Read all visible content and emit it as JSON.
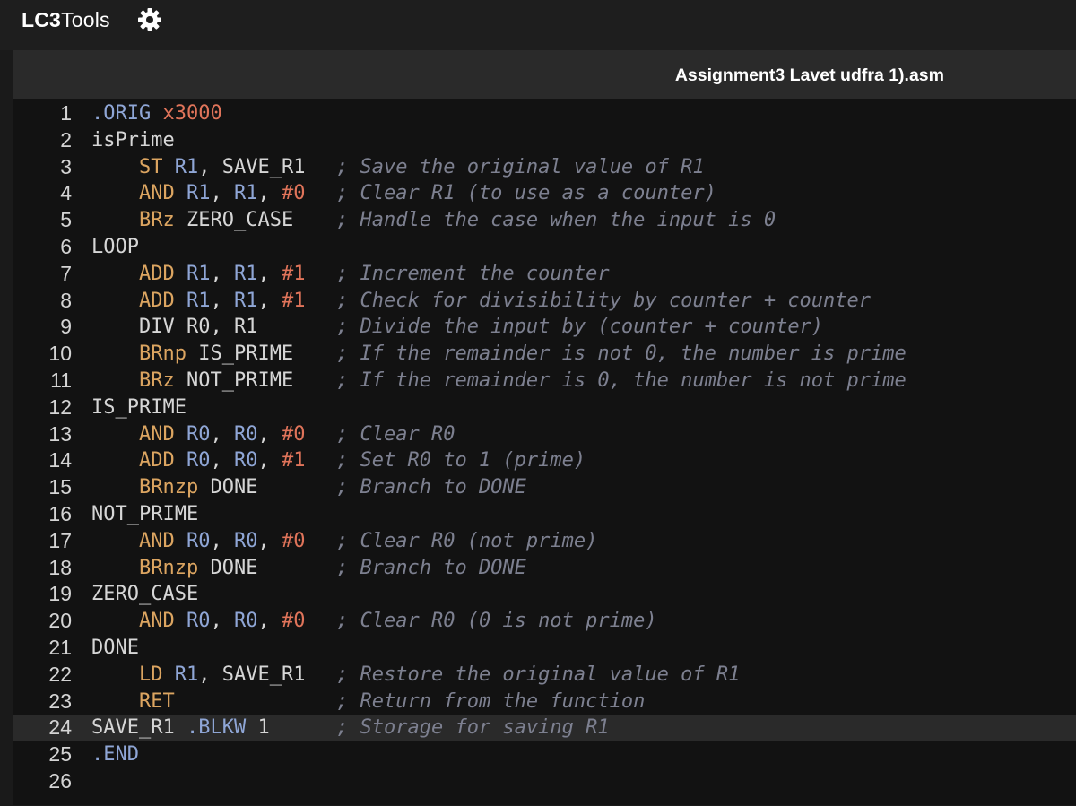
{
  "app": {
    "title_bold": "LC3",
    "title_rest": "Tools",
    "settings_icon": "gear-icon"
  },
  "tab": {
    "filename": "Assignment3 Lavet udfra 1).asm"
  },
  "colors": {
    "opcode": "#dca561",
    "register": "#8fa6d6",
    "number": "#e0745a",
    "directive": "#8fa6d6",
    "comment": "#7d8090",
    "text": "#d6d6d6",
    "editor_bg": "#121212",
    "active_line": "#2a2a2a"
  },
  "editor": {
    "active_line": 24,
    "lines": [
      {
        "n": "1",
        "indent": "",
        "tokens": [
          {
            "t": ".ORIG",
            "k": "dir"
          },
          {
            "t": " ",
            "k": "pun"
          },
          {
            "t": "x3000",
            "k": "num"
          }
        ],
        "comment": ""
      },
      {
        "n": "2",
        "indent": "",
        "tokens": [
          {
            "t": "isPrime",
            "k": "lbl"
          }
        ],
        "comment": ""
      },
      {
        "n": "3",
        "indent": "    ",
        "tokens": [
          {
            "t": "ST",
            "k": "op"
          },
          {
            "t": " ",
            "k": "pun"
          },
          {
            "t": "R1",
            "k": "reg"
          },
          {
            "t": ", ",
            "k": "pun"
          },
          {
            "t": "SAVE_R1",
            "k": "lbl"
          }
        ],
        "comment": "; Save the original value of R1"
      },
      {
        "n": "4",
        "indent": "    ",
        "tokens": [
          {
            "t": "AND",
            "k": "op"
          },
          {
            "t": " ",
            "k": "pun"
          },
          {
            "t": "R1",
            "k": "reg"
          },
          {
            "t": ", ",
            "k": "pun"
          },
          {
            "t": "R1",
            "k": "reg"
          },
          {
            "t": ", ",
            "k": "pun"
          },
          {
            "t": "#0",
            "k": "num"
          }
        ],
        "comment": "; Clear R1 (to use as a counter)"
      },
      {
        "n": "5",
        "indent": "    ",
        "tokens": [
          {
            "t": "BRz",
            "k": "op"
          },
          {
            "t": " ",
            "k": "pun"
          },
          {
            "t": "ZERO_CASE",
            "k": "lbl"
          }
        ],
        "comment": "; Handle the case when the input is 0"
      },
      {
        "n": "6",
        "indent": "",
        "tokens": [
          {
            "t": "LOOP",
            "k": "lbl"
          }
        ],
        "comment": ""
      },
      {
        "n": "7",
        "indent": "    ",
        "tokens": [
          {
            "t": "ADD",
            "k": "op"
          },
          {
            "t": " ",
            "k": "pun"
          },
          {
            "t": "R1",
            "k": "reg"
          },
          {
            "t": ", ",
            "k": "pun"
          },
          {
            "t": "R1",
            "k": "reg"
          },
          {
            "t": ", ",
            "k": "pun"
          },
          {
            "t": "#1",
            "k": "num"
          }
        ],
        "comment": "; Increment the counter"
      },
      {
        "n": "8",
        "indent": "    ",
        "tokens": [
          {
            "t": "ADD",
            "k": "op"
          },
          {
            "t": " ",
            "k": "pun"
          },
          {
            "t": "R1",
            "k": "reg"
          },
          {
            "t": ", ",
            "k": "pun"
          },
          {
            "t": "R1",
            "k": "reg"
          },
          {
            "t": ", ",
            "k": "pun"
          },
          {
            "t": "#1",
            "k": "num"
          }
        ],
        "comment": "; Check for divisibility by counter + counter"
      },
      {
        "n": "9",
        "indent": "    ",
        "tokens": [
          {
            "t": "DIV R0",
            "k": "lbl"
          },
          {
            "t": ", ",
            "k": "pun"
          },
          {
            "t": "R1",
            "k": "lbl"
          }
        ],
        "comment": "; Divide the input by (counter + counter)"
      },
      {
        "n": "10",
        "indent": "    ",
        "tokens": [
          {
            "t": "BRnp",
            "k": "op"
          },
          {
            "t": " ",
            "k": "pun"
          },
          {
            "t": "IS_PRIME",
            "k": "lbl"
          }
        ],
        "comment": "; If the remainder is not 0, the number is prime"
      },
      {
        "n": "11",
        "indent": "    ",
        "tokens": [
          {
            "t": "BRz",
            "k": "op"
          },
          {
            "t": " ",
            "k": "pun"
          },
          {
            "t": "NOT_PRIME",
            "k": "lbl"
          }
        ],
        "comment": "; If the remainder is 0, the number is not prime"
      },
      {
        "n": "12",
        "indent": "",
        "tokens": [
          {
            "t": "IS_PRIME",
            "k": "lbl"
          }
        ],
        "comment": ""
      },
      {
        "n": "13",
        "indent": "    ",
        "tokens": [
          {
            "t": "AND",
            "k": "op"
          },
          {
            "t": " ",
            "k": "pun"
          },
          {
            "t": "R0",
            "k": "reg"
          },
          {
            "t": ", ",
            "k": "pun"
          },
          {
            "t": "R0",
            "k": "reg"
          },
          {
            "t": ", ",
            "k": "pun"
          },
          {
            "t": "#0",
            "k": "num"
          }
        ],
        "comment": "; Clear R0"
      },
      {
        "n": "14",
        "indent": "    ",
        "tokens": [
          {
            "t": "ADD",
            "k": "op"
          },
          {
            "t": " ",
            "k": "pun"
          },
          {
            "t": "R0",
            "k": "reg"
          },
          {
            "t": ", ",
            "k": "pun"
          },
          {
            "t": "R0",
            "k": "reg"
          },
          {
            "t": ", ",
            "k": "pun"
          },
          {
            "t": "#1",
            "k": "num"
          }
        ],
        "comment": "; Set R0 to 1 (prime)"
      },
      {
        "n": "15",
        "indent": "    ",
        "tokens": [
          {
            "t": "BRnzp",
            "k": "op"
          },
          {
            "t": " ",
            "k": "pun"
          },
          {
            "t": "DONE",
            "k": "lbl"
          }
        ],
        "comment": "; Branch to DONE"
      },
      {
        "n": "16",
        "indent": "",
        "tokens": [
          {
            "t": "NOT_PRIME",
            "k": "lbl"
          }
        ],
        "comment": ""
      },
      {
        "n": "17",
        "indent": "    ",
        "tokens": [
          {
            "t": "AND",
            "k": "op"
          },
          {
            "t": " ",
            "k": "pun"
          },
          {
            "t": "R0",
            "k": "reg"
          },
          {
            "t": ", ",
            "k": "pun"
          },
          {
            "t": "R0",
            "k": "reg"
          },
          {
            "t": ", ",
            "k": "pun"
          },
          {
            "t": "#0",
            "k": "num"
          }
        ],
        "comment": "; Clear R0 (not prime)"
      },
      {
        "n": "18",
        "indent": "    ",
        "tokens": [
          {
            "t": "BRnzp",
            "k": "op"
          },
          {
            "t": " ",
            "k": "pun"
          },
          {
            "t": "DONE",
            "k": "lbl"
          }
        ],
        "comment": "; Branch to DONE"
      },
      {
        "n": "19",
        "indent": "",
        "tokens": [
          {
            "t": "ZERO_CASE",
            "k": "lbl"
          }
        ],
        "comment": ""
      },
      {
        "n": "20",
        "indent": "    ",
        "tokens": [
          {
            "t": "AND",
            "k": "op"
          },
          {
            "t": " ",
            "k": "pun"
          },
          {
            "t": "R0",
            "k": "reg"
          },
          {
            "t": ", ",
            "k": "pun"
          },
          {
            "t": "R0",
            "k": "reg"
          },
          {
            "t": ", ",
            "k": "pun"
          },
          {
            "t": "#0",
            "k": "num"
          }
        ],
        "comment": "; Clear R0 (0 is not prime)"
      },
      {
        "n": "21",
        "indent": "",
        "tokens": [
          {
            "t": "DONE",
            "k": "lbl"
          }
        ],
        "comment": ""
      },
      {
        "n": "22",
        "indent": "    ",
        "tokens": [
          {
            "t": "LD",
            "k": "op"
          },
          {
            "t": " ",
            "k": "pun"
          },
          {
            "t": "R1",
            "k": "reg"
          },
          {
            "t": ", ",
            "k": "pun"
          },
          {
            "t": "SAVE_R1",
            "k": "lbl"
          }
        ],
        "comment": "; Restore the original value of R1"
      },
      {
        "n": "23",
        "indent": "    ",
        "tokens": [
          {
            "t": "RET",
            "k": "op"
          }
        ],
        "comment": "; Return from the function"
      },
      {
        "n": "24",
        "indent": "",
        "tokens": [
          {
            "t": "SAVE_R1",
            "k": "lbl"
          },
          {
            "t": " ",
            "k": "pun"
          },
          {
            "t": ".BLKW",
            "k": "dir"
          },
          {
            "t": " ",
            "k": "pun"
          },
          {
            "t": "1",
            "k": "lbl"
          }
        ],
        "comment": "; Storage for saving R1"
      },
      {
        "n": "25",
        "indent": "",
        "tokens": [
          {
            "t": ".END",
            "k": "dir"
          }
        ],
        "comment": ""
      },
      {
        "n": "26",
        "indent": "",
        "tokens": [],
        "comment": ""
      }
    ]
  }
}
